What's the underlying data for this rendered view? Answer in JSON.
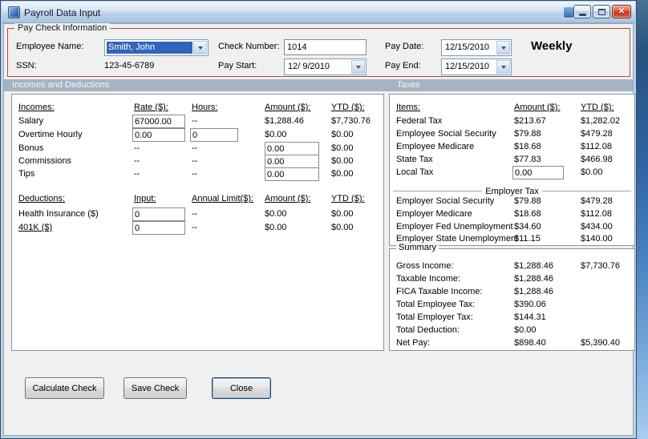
{
  "window": {
    "title": "Payroll Data Input",
    "close_glyph": "✕"
  },
  "paycheck": {
    "group_label": "Pay Check Information",
    "fields": {
      "employee_name": {
        "label": "Employee Name:",
        "value": "Smith, John"
      },
      "ssn": {
        "label": "SSN:",
        "value": "123-45-6789"
      },
      "check_number": {
        "label": "Check Number:",
        "value": "1014"
      },
      "pay_start": {
        "label": "Pay Start:",
        "value": "12/ 9/2010"
      },
      "pay_date": {
        "label": "Pay Date:",
        "value": "12/15/2010"
      },
      "pay_end": {
        "label": "Pay End:",
        "value": "12/15/2010"
      }
    },
    "frequency": "Weekly"
  },
  "section_headers": {
    "left": "Incomes and Deductions",
    "right": "Taxes"
  },
  "incomes": {
    "headers": {
      "name": "Incomes:",
      "rate": "Rate ($):",
      "hours": "Hours:",
      "amount": "Amount ($):",
      "ytd": "YTD ($):"
    },
    "rows": [
      {
        "name": "Salary",
        "rate": "67000.00",
        "hours": "--",
        "amount": "$1,288.46",
        "ytd": "$7,730.76"
      },
      {
        "name": "Overtime Hourly",
        "rate": "0.00",
        "hours": "0",
        "amount": "$0.00",
        "ytd": "$0.00"
      },
      {
        "name": "Bonus",
        "rate": "--",
        "hours": "--",
        "amount": "0.00",
        "ytd": "$0.00"
      },
      {
        "name": "Commissions",
        "rate": "--",
        "hours": "--",
        "amount": "0.00",
        "ytd": "$0.00"
      },
      {
        "name": "Tips",
        "rate": "--",
        "hours": "--",
        "amount": "0.00",
        "ytd": "$0.00"
      }
    ]
  },
  "deductions": {
    "headers": {
      "name": "Deductions:",
      "input": "Input:",
      "limit": "Annual Limit($):",
      "amount": "Amount ($):",
      "ytd": "YTD ($):"
    },
    "rows": [
      {
        "name": "Health Insurance ($)",
        "input": "0",
        "limit": "--",
        "amount": "$0.00",
        "ytd": "$0.00"
      },
      {
        "name": "401K ($)",
        "input": "0",
        "limit": "--",
        "amount": "$0.00",
        "ytd": "$0.00"
      }
    ]
  },
  "taxes": {
    "headers": {
      "item": "Items:",
      "amount": "Amount ($):",
      "ytd": "YTD ($):"
    },
    "employee_rows": [
      {
        "item": "Federal Tax",
        "amount": "$213.67",
        "ytd": "$1,282.02"
      },
      {
        "item": "Employee Social Security",
        "amount": "$79.88",
        "ytd": "$479.28"
      },
      {
        "item": "Employee Medicare",
        "amount": "$18.68",
        "ytd": "$112.08"
      },
      {
        "item": "State Tax",
        "amount": "$77.83",
        "ytd": "$466.98"
      },
      {
        "item": "Local Tax",
        "amount": "0.00",
        "ytd": "$0.00"
      }
    ],
    "employer_header": "Employer Tax",
    "employer_rows": [
      {
        "item": "Employer Social Security",
        "amount": "$79.88",
        "ytd": "$479.28"
      },
      {
        "item": "Employer Medicare",
        "amount": "$18.68",
        "ytd": "$112.08"
      },
      {
        "item": "Employer Fed Unemployment",
        "amount": "$34.60",
        "ytd": "$434.00"
      },
      {
        "item": "Employer State Unemployment",
        "amount": "$11.15",
        "ytd": "$140.00"
      }
    ]
  },
  "summary": {
    "group_label": "Summary",
    "rows": [
      {
        "item": "Gross Income:",
        "amount": "$1,288.46",
        "ytd": "$7,730.76"
      },
      {
        "item": "Taxable Income:",
        "amount": "$1,288.46",
        "ytd": ""
      },
      {
        "item": "FICA Taxable Income:",
        "amount": "$1,288.46",
        "ytd": ""
      },
      {
        "item": "Total Employee Tax:",
        "amount": "$390.06",
        "ytd": ""
      },
      {
        "item": "Total Employer Tax:",
        "amount": "$144.31",
        "ytd": ""
      },
      {
        "item": "Total Deduction:",
        "amount": "$0.00",
        "ytd": ""
      },
      {
        "item": "Net Pay:",
        "amount": "$898.40",
        "ytd": "$5,390.40"
      }
    ]
  },
  "buttons": {
    "calculate": "Calculate Check",
    "save": "Save Check",
    "close": "Close"
  },
  "colors": {
    "groupbox_border": "#a94f44",
    "section_strip": "#a6b3c3",
    "selection_highlight": "#3165bd",
    "close_button": "#c23a22"
  }
}
